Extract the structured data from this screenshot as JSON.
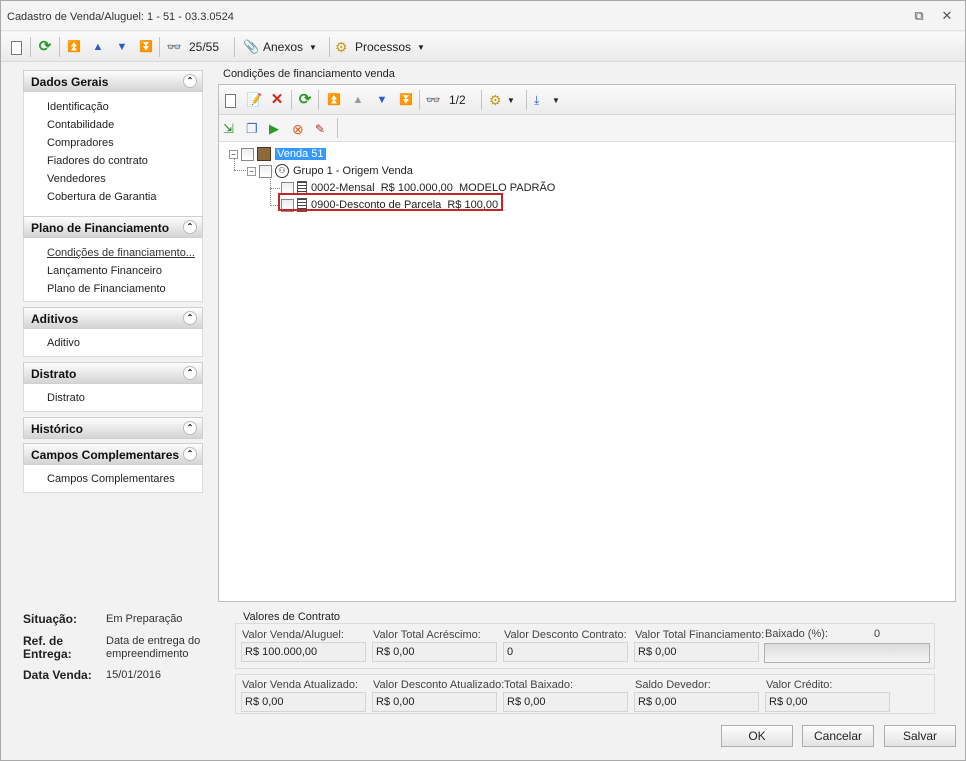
{
  "window": {
    "title": "Cadastro de Venda/Aluguel: 1 - 51 - 03.3.0524"
  },
  "toolbar": {
    "record_counter": "25/55",
    "anexos_label": "Anexos",
    "processos_label": "Processos"
  },
  "sidebar": {
    "groups": [
      {
        "title": "Dados Gerais",
        "items": [
          "Identificação",
          "Contabilidade",
          "Compradores",
          "Fiadores do contrato",
          "Vendedores",
          "Cobertura de Garantia"
        ]
      },
      {
        "title": "Plano de Financiamento",
        "items": [
          "Condições de financiamento...",
          "Lançamento Financeiro",
          "Plano de Financiamento"
        ]
      },
      {
        "title": "Aditivos",
        "items": [
          "Aditivo"
        ]
      },
      {
        "title": "Distrato",
        "items": [
          "Distrato"
        ]
      },
      {
        "title": "Histórico",
        "items": []
      },
      {
        "title": "Campos Complementares",
        "items": [
          "Campos Complementares"
        ]
      }
    ]
  },
  "main": {
    "section_title": "Condições de financiamento venda",
    "subtoolbar": {
      "record_counter": "1/2"
    },
    "tree": {
      "root": "Venda 51",
      "group": "Grupo 1 - Origem Venda",
      "items": [
        "0002-Mensal  R$ 100.000,00  MODELO PADRÃO",
        "0900-Desconto de Parcela  R$ 100,00"
      ]
    }
  },
  "info": {
    "situacao_label": "Situação:",
    "situacao_value": "Em Preparação",
    "ref_entrega_label_1": "Ref. de",
    "ref_entrega_label_2": "Entrega:",
    "ref_entrega_value_1": "Data de entrega do",
    "ref_entrega_value_2": "empreendimento",
    "data_venda_label": "Data Venda:",
    "data_venda_value": "15/01/2016"
  },
  "valores": {
    "title": "Valores de Contrato",
    "row1": [
      {
        "label": "Valor Venda/Aluguel:",
        "value": "R$ 100.000,00"
      },
      {
        "label": "Valor Total Acréscimo:",
        "value": "R$ 0,00"
      },
      {
        "label": "Valor Desconto Contrato:",
        "value": "0"
      },
      {
        "label": "Valor Total Financiamento:",
        "value": "R$ 0,00"
      }
    ],
    "baixado_label": "Baixado (%):",
    "baixado_value": "0",
    "row2": [
      {
        "label": "Valor Venda Atualizado:",
        "value": "R$ 0,00"
      },
      {
        "label": "Valor Desconto Atualizado:",
        "value": "R$ 0,00"
      },
      {
        "label": "Total Baixado:",
        "value": "R$ 0,00"
      },
      {
        "label": "Saldo Devedor:",
        "value": "R$ 0,00"
      },
      {
        "label": "Valor Crédito:",
        "value": "R$ 0,00"
      }
    ]
  },
  "buttons": {
    "ok": "OK",
    "cancel": "Cancelar",
    "save": "Salvar"
  },
  "colors": {
    "selection": "#3399ff",
    "highlight_border": "#c0262a",
    "refresh_green": "#2a9a2a",
    "delete_red": "#d42a1e"
  }
}
